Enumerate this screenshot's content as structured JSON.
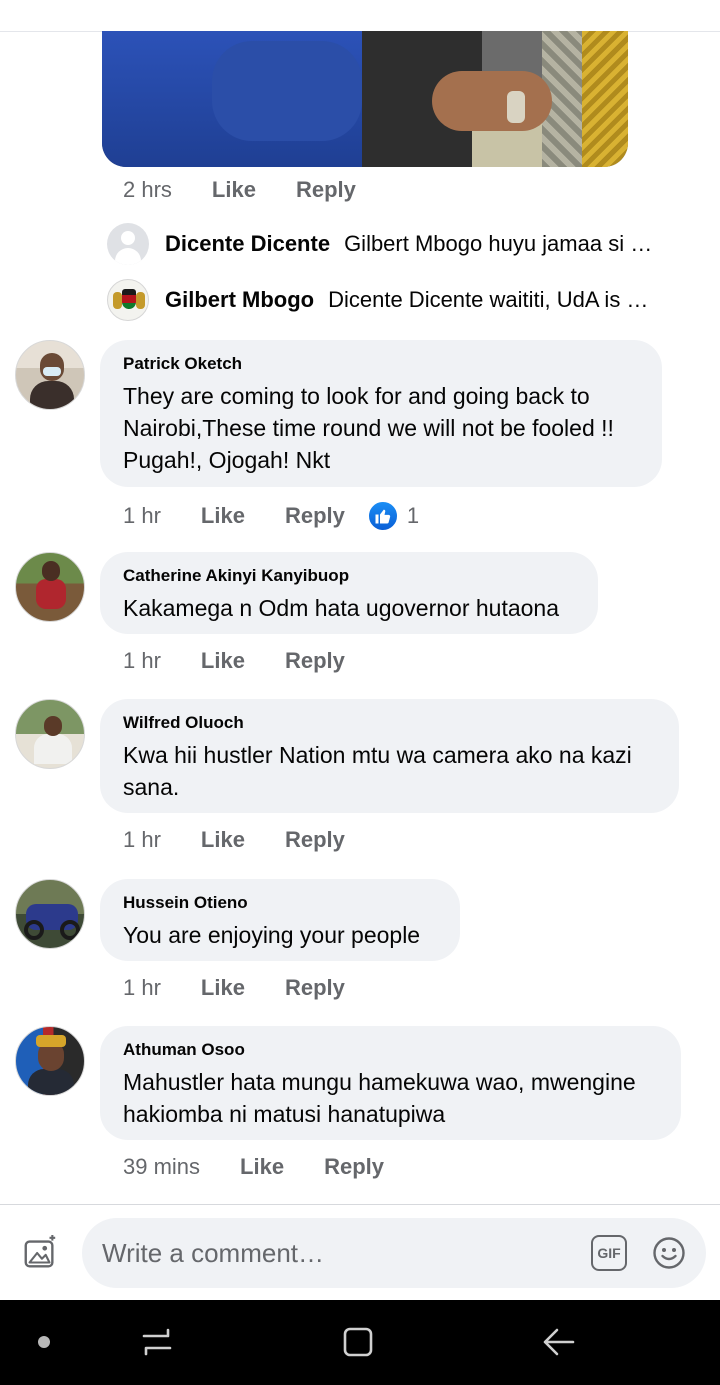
{
  "post": {
    "meta": {
      "time": "2 hrs",
      "like": "Like",
      "reply": "Reply"
    },
    "replies": [
      {
        "name": "Dicente Dicente",
        "text": "Gilbert Mbogo huyu jamaa si …"
      },
      {
        "name": "Gilbert Mbogo",
        "text": "Dicente Dicente waititi, UdA is …"
      }
    ]
  },
  "comments": [
    {
      "author": "Patrick Oketch",
      "text": "They are coming to look for and going back to Nairobi,These time round we will not be fooled !! Pugah!, Ojogah! Nkt",
      "time": "1 hr",
      "like": "Like",
      "reply": "Reply",
      "reactions": {
        "type": "like",
        "count": "1"
      }
    },
    {
      "author": "Catherine Akinyi Kanyibuop",
      "text": "Kakamega n Odm hata ugovernor hutaona",
      "time": "1 hr",
      "like": "Like",
      "reply": "Reply"
    },
    {
      "author": "Wilfred Oluoch",
      "text": "Kwa hii hustler Nation mtu wa camera ako na kazi sana.",
      "time": "1 hr",
      "like": "Like",
      "reply": "Reply"
    },
    {
      "author": "Hussein Otieno",
      "text": "You are enjoying your people",
      "time": "1 hr",
      "like": "Like",
      "reply": "Reply"
    },
    {
      "author": "Athuman Osoo",
      "text": "Mahustler hata mungu hamekuwa wao, mwengine hakiomba ni matusi hanatupiwa",
      "time": "39 mins",
      "like": "Like",
      "reply": "Reply"
    }
  ],
  "composer": {
    "placeholder": "Write a comment…",
    "gif_label": "GIF",
    "photo_icon": "photo-icon",
    "emoji_icon": "emoji-icon"
  },
  "colors": {
    "bubble": "#f0f2f5",
    "meta_text": "#65676b",
    "like_blue": "#1877f2"
  }
}
